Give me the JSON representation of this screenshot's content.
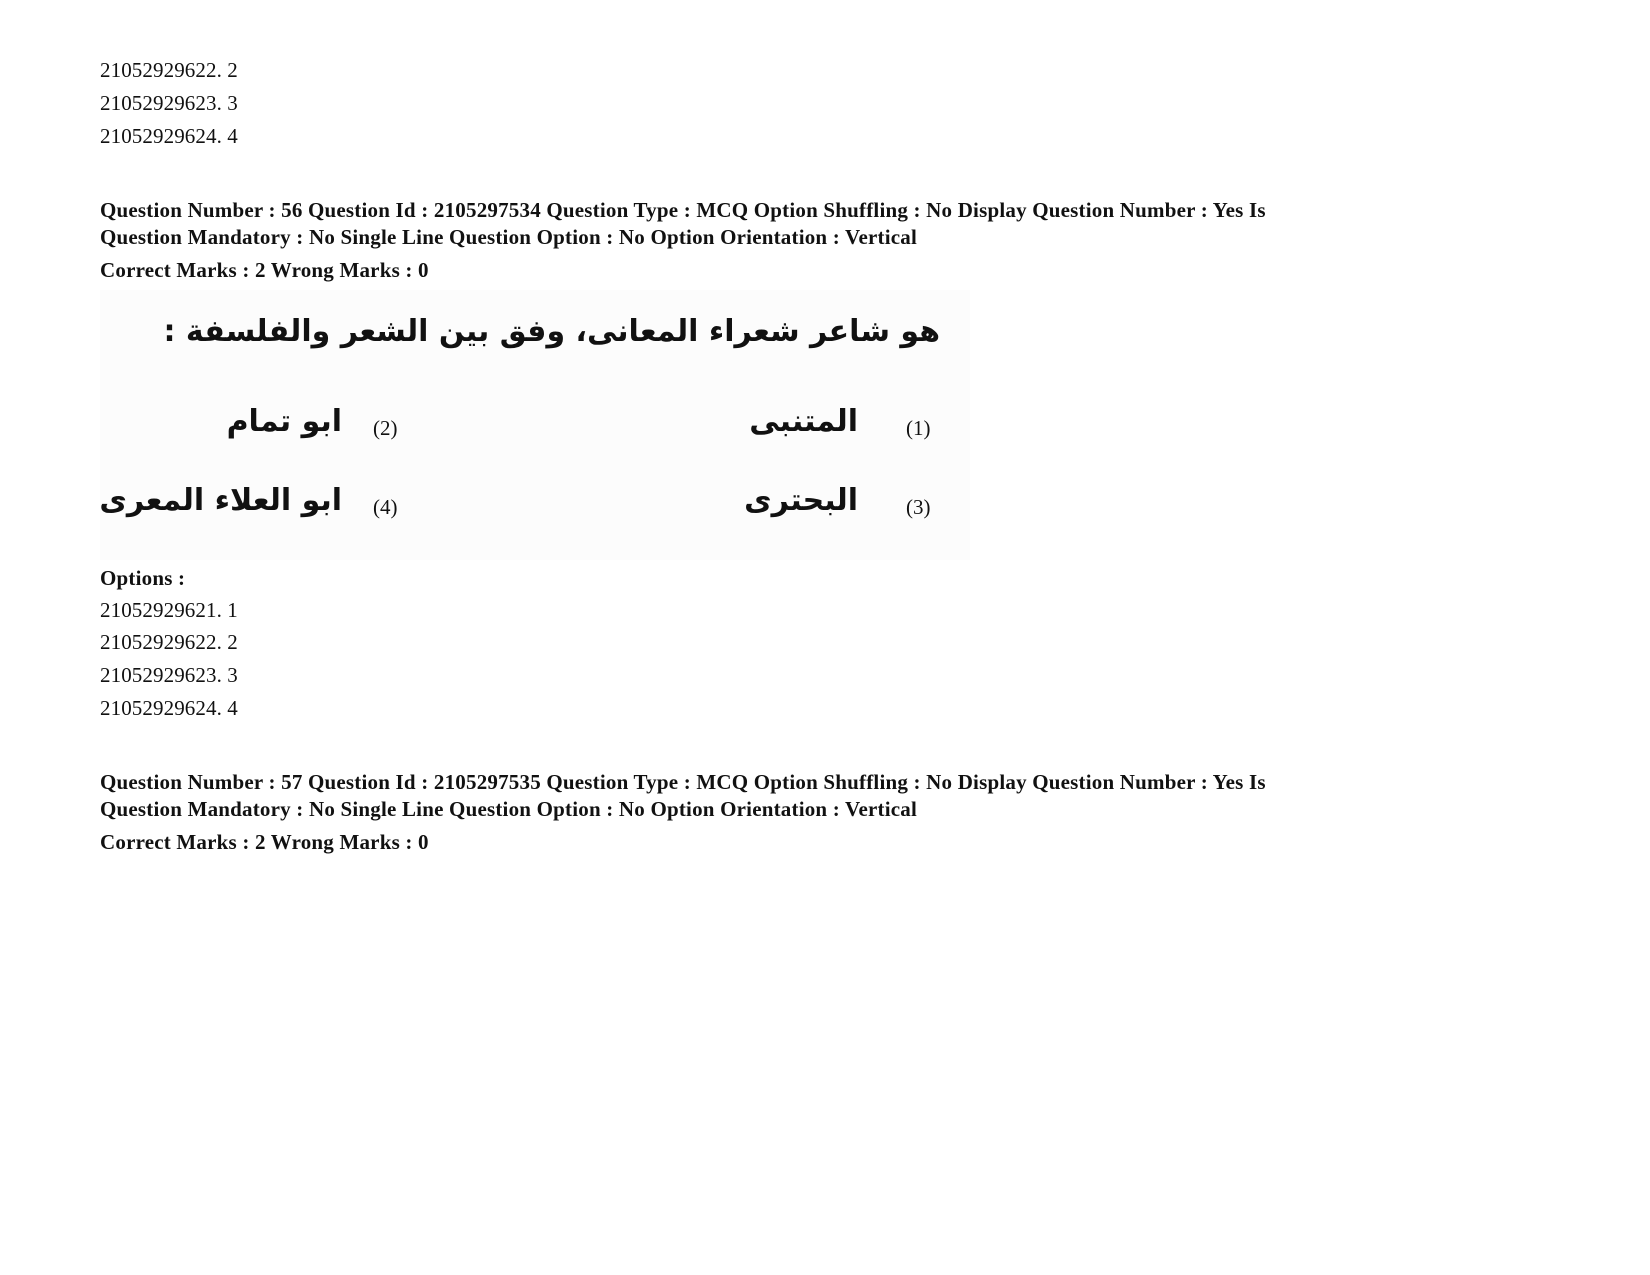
{
  "prev_options_tail": [
    {
      "id": "21052929622",
      "label": "2"
    },
    {
      "id": "21052929623",
      "label": "3"
    },
    {
      "id": "21052929624",
      "label": "4"
    }
  ],
  "q56": {
    "header_line1": "Question Number : 56 Question Id : 2105297534 Question Type : MCQ Option Shuffling : No Display Question Number : Yes Is",
    "header_line2": "Question Mandatory : No Single Line Question Option : No Option Orientation : Vertical",
    "marks": "Correct Marks : 2 Wrong Marks : 0",
    "image": {
      "question_text": "هو شاعر شعراء المعانى، وفق بين الشعر والفلسفة :",
      "choices": [
        {
          "num": "(1)",
          "text": "المتنبى"
        },
        {
          "num": "(2)",
          "text": "ابو تمام"
        },
        {
          "num": "(3)",
          "text": "البحترى"
        },
        {
          "num": "(4)",
          "text": "ابو العلاء المعرى"
        }
      ]
    },
    "options_label": "Options :",
    "options": [
      {
        "text": "21052929621. 1"
      },
      {
        "text": "21052929622. 2"
      },
      {
        "text": "21052929623. 3"
      },
      {
        "text": "21052929624. 4"
      }
    ]
  },
  "q57": {
    "header_line1": "Question Number : 57 Question Id : 2105297535 Question Type : MCQ Option Shuffling : No Display Question Number : Yes Is",
    "header_line2": "Question Mandatory : No Single Line Question Option : No Option Orientation : Vertical",
    "marks": "Correct Marks : 2 Wrong Marks : 0"
  },
  "prev_tail_text": [
    "21052929622. 2",
    "21052929623. 3",
    "21052929624. 4"
  ]
}
